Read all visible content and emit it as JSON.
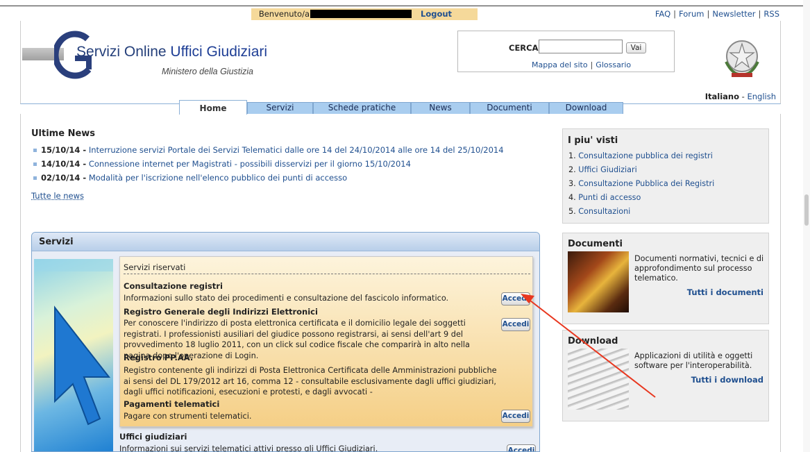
{
  "topbar": {
    "welcome_label": "Benvenuto/a",
    "logout_label": "Logout",
    "links": [
      "FAQ",
      "Forum",
      "Newsletter",
      "RSS"
    ]
  },
  "header": {
    "logo_part1": "S",
    "logo_part2": "ervizi Online ",
    "logo_part3": "Uffici Giudiziari",
    "logo_subtitle": "Ministero della Giustizia",
    "search_label": "CERCA",
    "search_value": "",
    "search_button": "Vai",
    "sitemap_link": "Mappa del sito",
    "glossary_link": "Glossario",
    "lang_current": "Italiano",
    "lang_sep": "-",
    "lang_other": "English"
  },
  "tabs": [
    "Home",
    "Servizi",
    "Schede pratiche",
    "News",
    "Documenti",
    "Download"
  ],
  "news": {
    "title": "Ultime News",
    "items": [
      {
        "date": "15/10/14 -",
        "text": "Interruzione servizi Portale dei Servizi Telematici dalle ore 14 del 24/10/2014 alle ore 14 del 25/10/2014"
      },
      {
        "date": "14/10/14 -",
        "text": "Connessione internet per Magistrati - possibili disservizi per il giorno 15/10/2014"
      },
      {
        "date": "02/10/14 -",
        "text": "Modalità per l'iscrizione nell'elenco pubblico dei punti di accesso"
      }
    ],
    "all_link": "Tutte le news"
  },
  "servizi": {
    "title": "Servizi",
    "reserved_title": "Servizi riservati",
    "items": [
      {
        "name": "Consultazione registri",
        "desc": "Informazioni sullo stato dei procedimenti e consultazione del fascicolo informatico."
      },
      {
        "name": "Registro Generale degli Indirizzi Elettronici",
        "desc": "Per conoscere l'indirizzo di posta elettronica certificata e il domicilio legale dei soggetti registrati. I professionisti ausiliari del giudice possono registrarsi, ai sensi dell'art 9 del provvedimento 18 luglio 2011, con un click sul codice fiscale che comparirà in alto nella pagina dopo l'operazione di Login."
      },
      {
        "name": "Registro PP.AA.",
        "desc": "Registro contenente gli indirizzi di Posta Elettronica Certificata delle Amministrazioni pubbliche ai sensi del DL 179/2012 art 16, comma 12 - consultabile esclusivamente dagli uffici giudiziari, dagli uffici notificazioni, esecuzioni e protesti, e dagli avvocati -"
      },
      {
        "name": "Pagamenti telematici",
        "desc": "Pagare con strumenti telematici."
      }
    ],
    "accedi_label": "Accedi",
    "uffici_name": "Uffici giudiziari",
    "uffici_desc": "Informazioni sui servizi telematici attivi presso gli Uffici Giudiziari."
  },
  "sidebar": {
    "visti_title": "I piu' visti",
    "visti": [
      {
        "n": "1.",
        "text": "Consultazione pubblica dei registri"
      },
      {
        "n": "2.",
        "text": "Uffici Giudiziari"
      },
      {
        "n": "3.",
        "text": "Consultazione Pubblica dei Registri"
      },
      {
        "n": "4.",
        "text": "Punti di accesso"
      },
      {
        "n": "5.",
        "text": "Consultazioni"
      }
    ],
    "documenti_title": "Documenti",
    "documenti_desc": "Documenti normativi, tecnici e di approfondimento sul processo telematico.",
    "documenti_link": "Tutti i documenti",
    "download_title": "Download",
    "download_desc": "Applicazioni di utilità e oggetti software per l'interoperabilità.",
    "download_link": "Tutti i download"
  },
  "colors": {
    "link": "#1f4f8f",
    "tab": "#a9cdef",
    "reserved_bg": "#f5cf86",
    "annotation_arrow": "#e8371f"
  }
}
